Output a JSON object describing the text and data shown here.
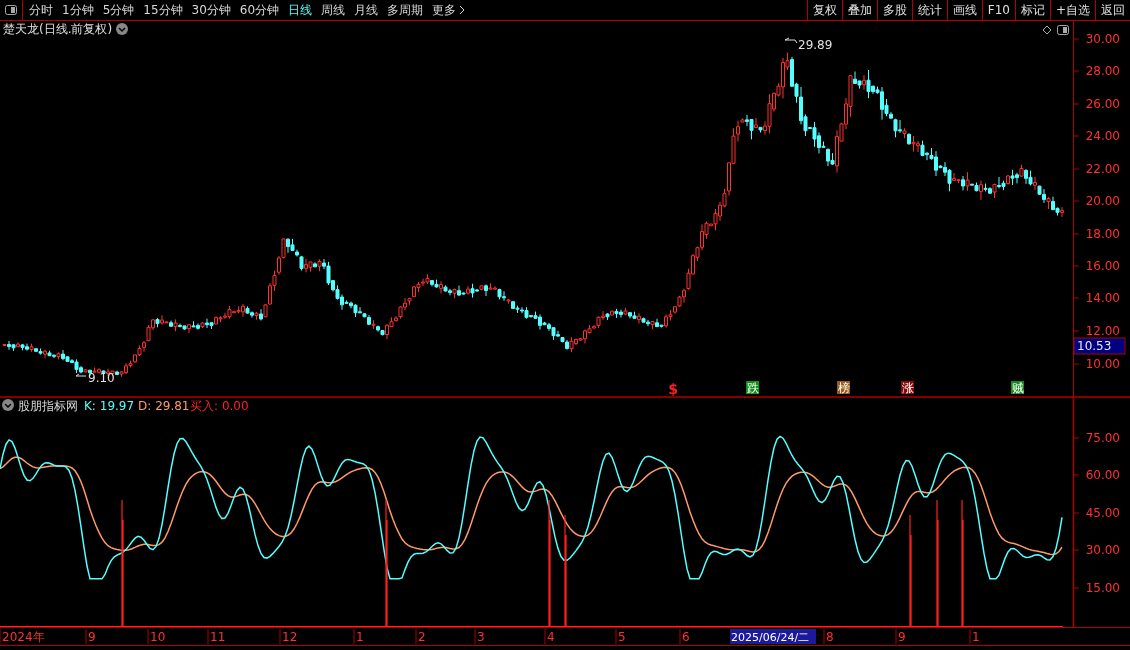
{
  "toolbar": {
    "periods": [
      {
        "label": "分时",
        "selected": false
      },
      {
        "label": "1分钟",
        "selected": false
      },
      {
        "label": "5分钟",
        "selected": false
      },
      {
        "label": "15分钟",
        "selected": false
      },
      {
        "label": "30分钟",
        "selected": false
      },
      {
        "label": "60分钟",
        "selected": false
      },
      {
        "label": "日线",
        "selected": true
      },
      {
        "label": "周线",
        "selected": false
      },
      {
        "label": "月线",
        "selected": false
      },
      {
        "label": "多周期",
        "selected": false
      },
      {
        "label": "更多",
        "selected": false
      }
    ],
    "buttons": [
      "复权",
      "叠加",
      "多股",
      "统计",
      "画线",
      "F10",
      "标记",
      "+自选",
      "返回"
    ]
  },
  "main_chart": {
    "title": "楚天龙(日线.前复权)",
    "high_label": "29.89",
    "low_label": "9.10",
    "y_axis": [
      "30.00",
      "28.00",
      "26.00",
      "24.00",
      "22.00",
      "20.00",
      "18.00",
      "16.00",
      "14.00",
      "12.00",
      "10.00"
    ],
    "current_price": "10.53",
    "signals": [
      {
        "text": "$",
        "kind": "mark",
        "color": "#ff2020"
      },
      {
        "text": "跌",
        "kind": "tag",
        "color": "#10901a"
      },
      {
        "text": "榜",
        "kind": "tag",
        "color": "#9a5a12"
      },
      {
        "text": "涨",
        "kind": "tag",
        "color": "#8a0a0a"
      },
      {
        "text": "贼",
        "kind": "tag",
        "color": "#138a1c"
      }
    ]
  },
  "indicator": {
    "name": "股朋指标网",
    "values": [
      {
        "label": "K:",
        "value": "19.97",
        "color": "#54ffff"
      },
      {
        "label": "D:",
        "value": "29.81",
        "color": "#ff9a66"
      },
      {
        "label": "买入:",
        "value": "0.00",
        "color": "#ff2020"
      }
    ],
    "y_axis": [
      "75.00",
      "60.00",
      "45.00",
      "30.00",
      "15.00"
    ]
  },
  "date_axis": [
    {
      "text": "2024年",
      "selected": false
    },
    {
      "text": "9",
      "selected": false
    },
    {
      "text": "10",
      "selected": false
    },
    {
      "text": "11",
      "selected": false
    },
    {
      "text": "12",
      "selected": false
    },
    {
      "text": "1",
      "selected": false
    },
    {
      "text": "2",
      "selected": false
    },
    {
      "text": "3",
      "selected": false
    },
    {
      "text": "4",
      "selected": false
    },
    {
      "text": "5",
      "selected": false
    },
    {
      "text": "6",
      "selected": false
    },
    {
      "text": "2025/06/24/二",
      "selected": true
    },
    {
      "text": "8",
      "selected": false
    },
    {
      "text": "9",
      "selected": false
    },
    {
      "text": "1",
      "selected": false
    }
  ]
}
